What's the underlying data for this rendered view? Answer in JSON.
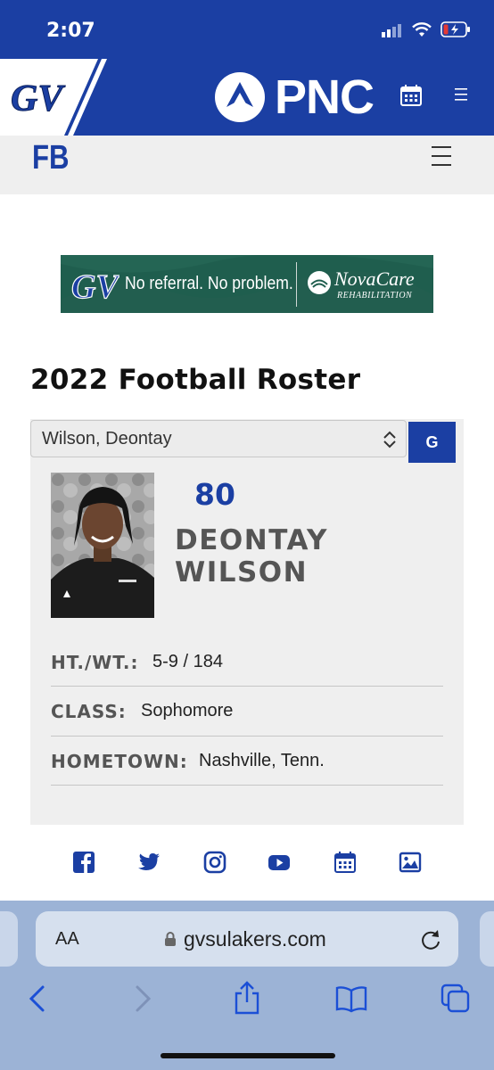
{
  "status_bar": {
    "time": "2:07"
  },
  "header": {
    "sponsor": "PNC",
    "sport": "FB"
  },
  "ad": {
    "tagline": "No referral. No problem.",
    "brand": "NovaCare",
    "brand_sub": "REHABILITATION"
  },
  "roster": {
    "title": "2022 Football Roster",
    "selected_player": "Wilson, Deontay",
    "go_label": "G"
  },
  "player": {
    "number": "80",
    "first_name": "DEONTAY",
    "last_name": "WILSON",
    "fields": [
      {
        "label": "HT./WT.:",
        "value": "5-9 / 184"
      },
      {
        "label": "CLASS:",
        "value": "Sophomore"
      },
      {
        "label": "HOMETOWN:",
        "value": "Nashville, Tenn."
      }
    ]
  },
  "social": [
    "facebook-icon",
    "twitter-icon",
    "instagram-icon",
    "youtube-icon",
    "calendar-icon",
    "gallery-icon"
  ],
  "browser": {
    "aa_label": "AA",
    "url": "gvsulakers.com"
  },
  "colors": {
    "brand_blue": "#1b3fa3",
    "ad_green": "#1f5e4e",
    "card_gray": "#efefef"
  }
}
